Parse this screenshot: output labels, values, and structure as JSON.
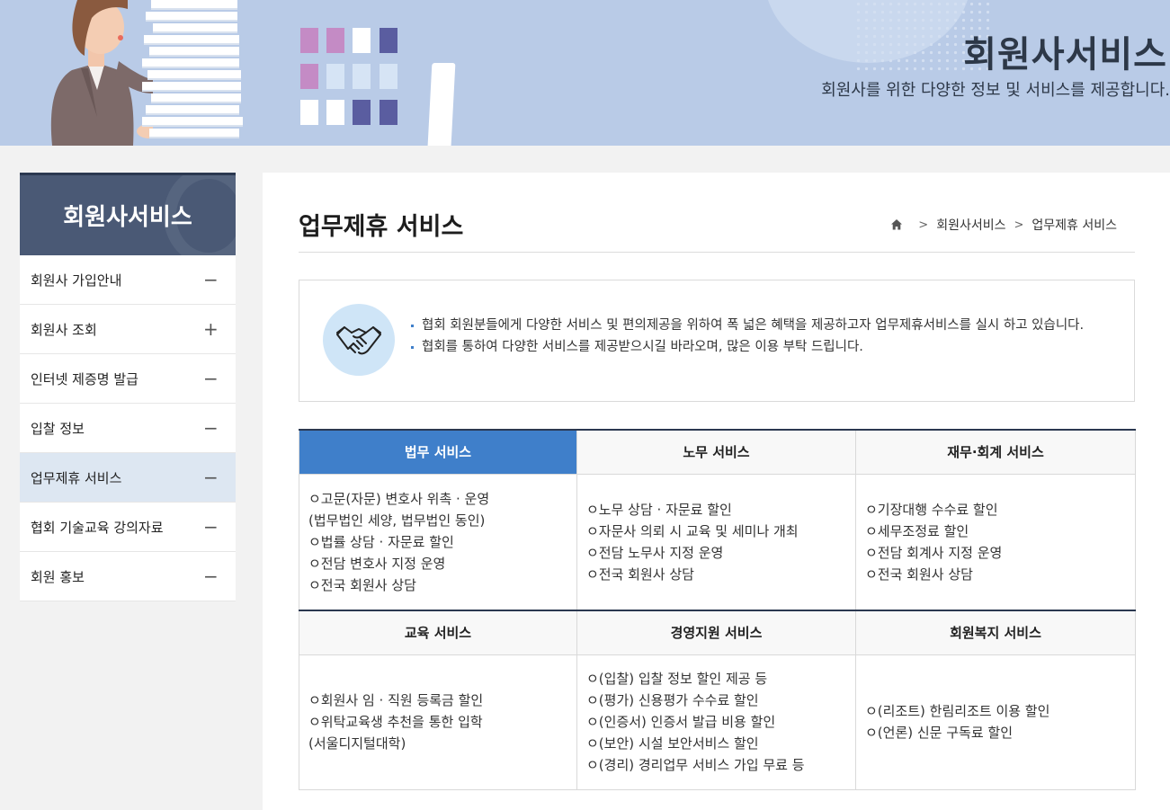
{
  "banner": {
    "title": "회원사서비스",
    "subtitle": "회원사를 위한 다양한 정보 및 서비스를 제공합니다."
  },
  "sidebar": {
    "title": "회원사서비스",
    "items": [
      {
        "label": "회원사 가입안내",
        "sign": "−"
      },
      {
        "label": "회원사 조회",
        "sign": "+"
      },
      {
        "label": "인터넷 제증명 발급",
        "sign": "−"
      },
      {
        "label": "입찰 정보",
        "sign": "−"
      },
      {
        "label": "업무제휴 서비스",
        "sign": "−"
      },
      {
        "label": "협회 기술교육 강의자료",
        "sign": "−"
      },
      {
        "label": "회원 홍보",
        "sign": "−"
      }
    ]
  },
  "main": {
    "title": "업무제휴 서비스",
    "breadcrumb": [
      "회원사서비스",
      "업무제휴 서비스"
    ],
    "intro": [
      "협회 회원분들에게 다양한 서비스 및 편의제공을 위하여 폭 넓은 혜택을 제공하고자 업무제휴서비스를 실시 하고 있습니다.",
      "협회를 통하여 다양한 서비스를 제공받으시길 바라오며, 많은 이용 부탁 드립니다."
    ]
  },
  "services": {
    "row1": [
      {
        "title": "법무 서비스",
        "lines": [
          "ㅇ고문(자문) 변호사 위촉 · 운영",
          "(법무법인 세양, 법무법인 동인)",
          "ㅇ법률 상담 · 자문료 할인",
          "ㅇ전담 변호사 지정 운영",
          "ㅇ전국 회원사 상담"
        ]
      },
      {
        "title": "노무 서비스",
        "lines": [
          "ㅇ노무 상담 · 자문료 할인",
          "ㅇ자문사 의뢰 시 교육 및 세미나 개최",
          "ㅇ전담 노무사 지정 운영",
          "ㅇ전국 회원사 상담"
        ]
      },
      {
        "title": "재무·회계 서비스",
        "lines": [
          "ㅇ기장대행 수수료 할인",
          "ㅇ세무조정료 할인",
          "ㅇ전담 회계사 지정 운영",
          "ㅇ전국 회원사 상담"
        ]
      }
    ],
    "row2": [
      {
        "title": "교육 서비스",
        "lines": [
          "ㅇ회원사 임 · 직원 등록금 할인",
          "ㅇ위탁교육생 추천을 통한 입학",
          "(서울디지털대학)"
        ]
      },
      {
        "title": "경영지원 서비스",
        "lines": [
          "ㅇ(입찰) 입찰 정보 할인 제공 등",
          "ㅇ(평가) 신용평가 수수료 할인",
          "ㅇ(인증서) 인증서 발급 비용 할인",
          "ㅇ(보안) 시설 보안서비스 할인",
          "ㅇ(경리) 경리업무 서비스 가입 무료 등"
        ]
      },
      {
        "title": "회원복지 서비스",
        "lines": [
          "ㅇ(리조트) 한림리조트 이용 할인",
          "ㅇ(언론) 신문 구독료 할인"
        ]
      }
    ],
    "active_index": 0
  },
  "colors": {
    "banner_bg": "#b9cbe7",
    "sidebar_head": "#4a5975",
    "active_tab": "#3f7fca",
    "active_side_item": "#dde7f2"
  }
}
